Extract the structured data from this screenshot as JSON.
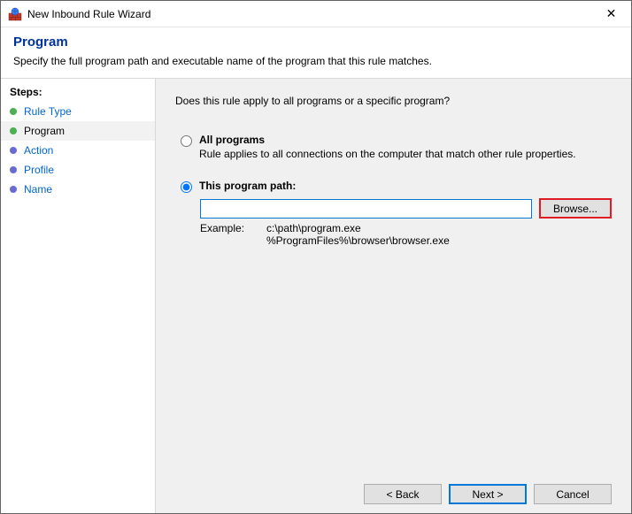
{
  "window": {
    "title": "New Inbound Rule Wizard",
    "close_glyph": "✕"
  },
  "header": {
    "title": "Program",
    "subtitle": "Specify the full program path and executable name of the program that this rule matches."
  },
  "sidebar": {
    "title": "Steps:",
    "items": [
      {
        "label": "Rule Type",
        "done": true,
        "active": false
      },
      {
        "label": "Program",
        "done": true,
        "active": true
      },
      {
        "label": "Action",
        "done": false,
        "active": false
      },
      {
        "label": "Profile",
        "done": false,
        "active": false
      },
      {
        "label": "Name",
        "done": false,
        "active": false
      }
    ]
  },
  "content": {
    "question": "Does this rule apply to all programs or a specific program?",
    "options": {
      "all": {
        "label": "All programs",
        "desc": "Rule applies to all connections on the computer that match other rule properties."
      },
      "path": {
        "label": "This program path:",
        "value": "",
        "browse_label": "Browse...",
        "example_label": "Example:",
        "example_text": "c:\\path\\program.exe\n%ProgramFiles%\\browser\\browser.exe"
      }
    }
  },
  "footer": {
    "back": "< Back",
    "next": "Next >",
    "cancel": "Cancel"
  }
}
